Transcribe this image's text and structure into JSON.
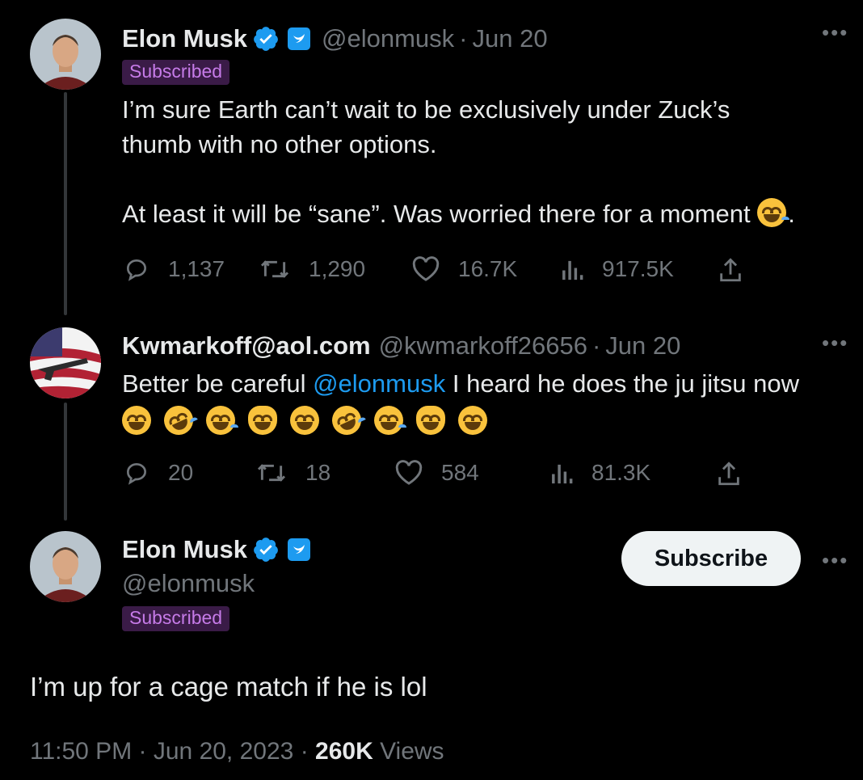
{
  "tweet1": {
    "name": "Elon Musk",
    "handle": "@elonmusk",
    "date": "Jun 20",
    "badge": "Subscribed",
    "line1": "I’m sure Earth can’t wait to be exclusively under Zuck’s",
    "line2": "thumb with no other options.",
    "line3": "At least it will be “sane”. Was worried there for a moment",
    "line3_end": ".",
    "replies": "1,137",
    "retweets": "1,290",
    "likes": "16.7K",
    "views": "917.5K"
  },
  "tweet2": {
    "name": "Kwmarkoff@aol.com",
    "handle": "@kwmarkoff26656",
    "date": "Jun 20",
    "text_before": "Better be careful ",
    "mention": "@elonmusk",
    "text_after": " I heard he does the ju jitsu now",
    "replies": "20",
    "retweets": "18",
    "likes": "584",
    "views": "81.3K"
  },
  "main": {
    "name": "Elon Musk",
    "handle": "@elonmusk",
    "badge": "Subscribed",
    "subscribe_label": "Subscribe",
    "text": "I’m up for a cage match if he is lol",
    "time": "11:50 PM",
    "date": "Jun 20, 2023",
    "views_count": "260K",
    "views_label": "Views"
  },
  "colors": {
    "background": "#000000",
    "text": "#e7e9ea",
    "muted": "#71767b",
    "link": "#1d9bf0",
    "badge_bg": "#3a1b47",
    "badge_text": "#c67be8"
  },
  "icons": [
    "verified-badge-icon",
    "affiliate-icon",
    "reply-icon",
    "retweet-icon",
    "like-icon",
    "views-icon",
    "share-icon",
    "more-icon"
  ]
}
